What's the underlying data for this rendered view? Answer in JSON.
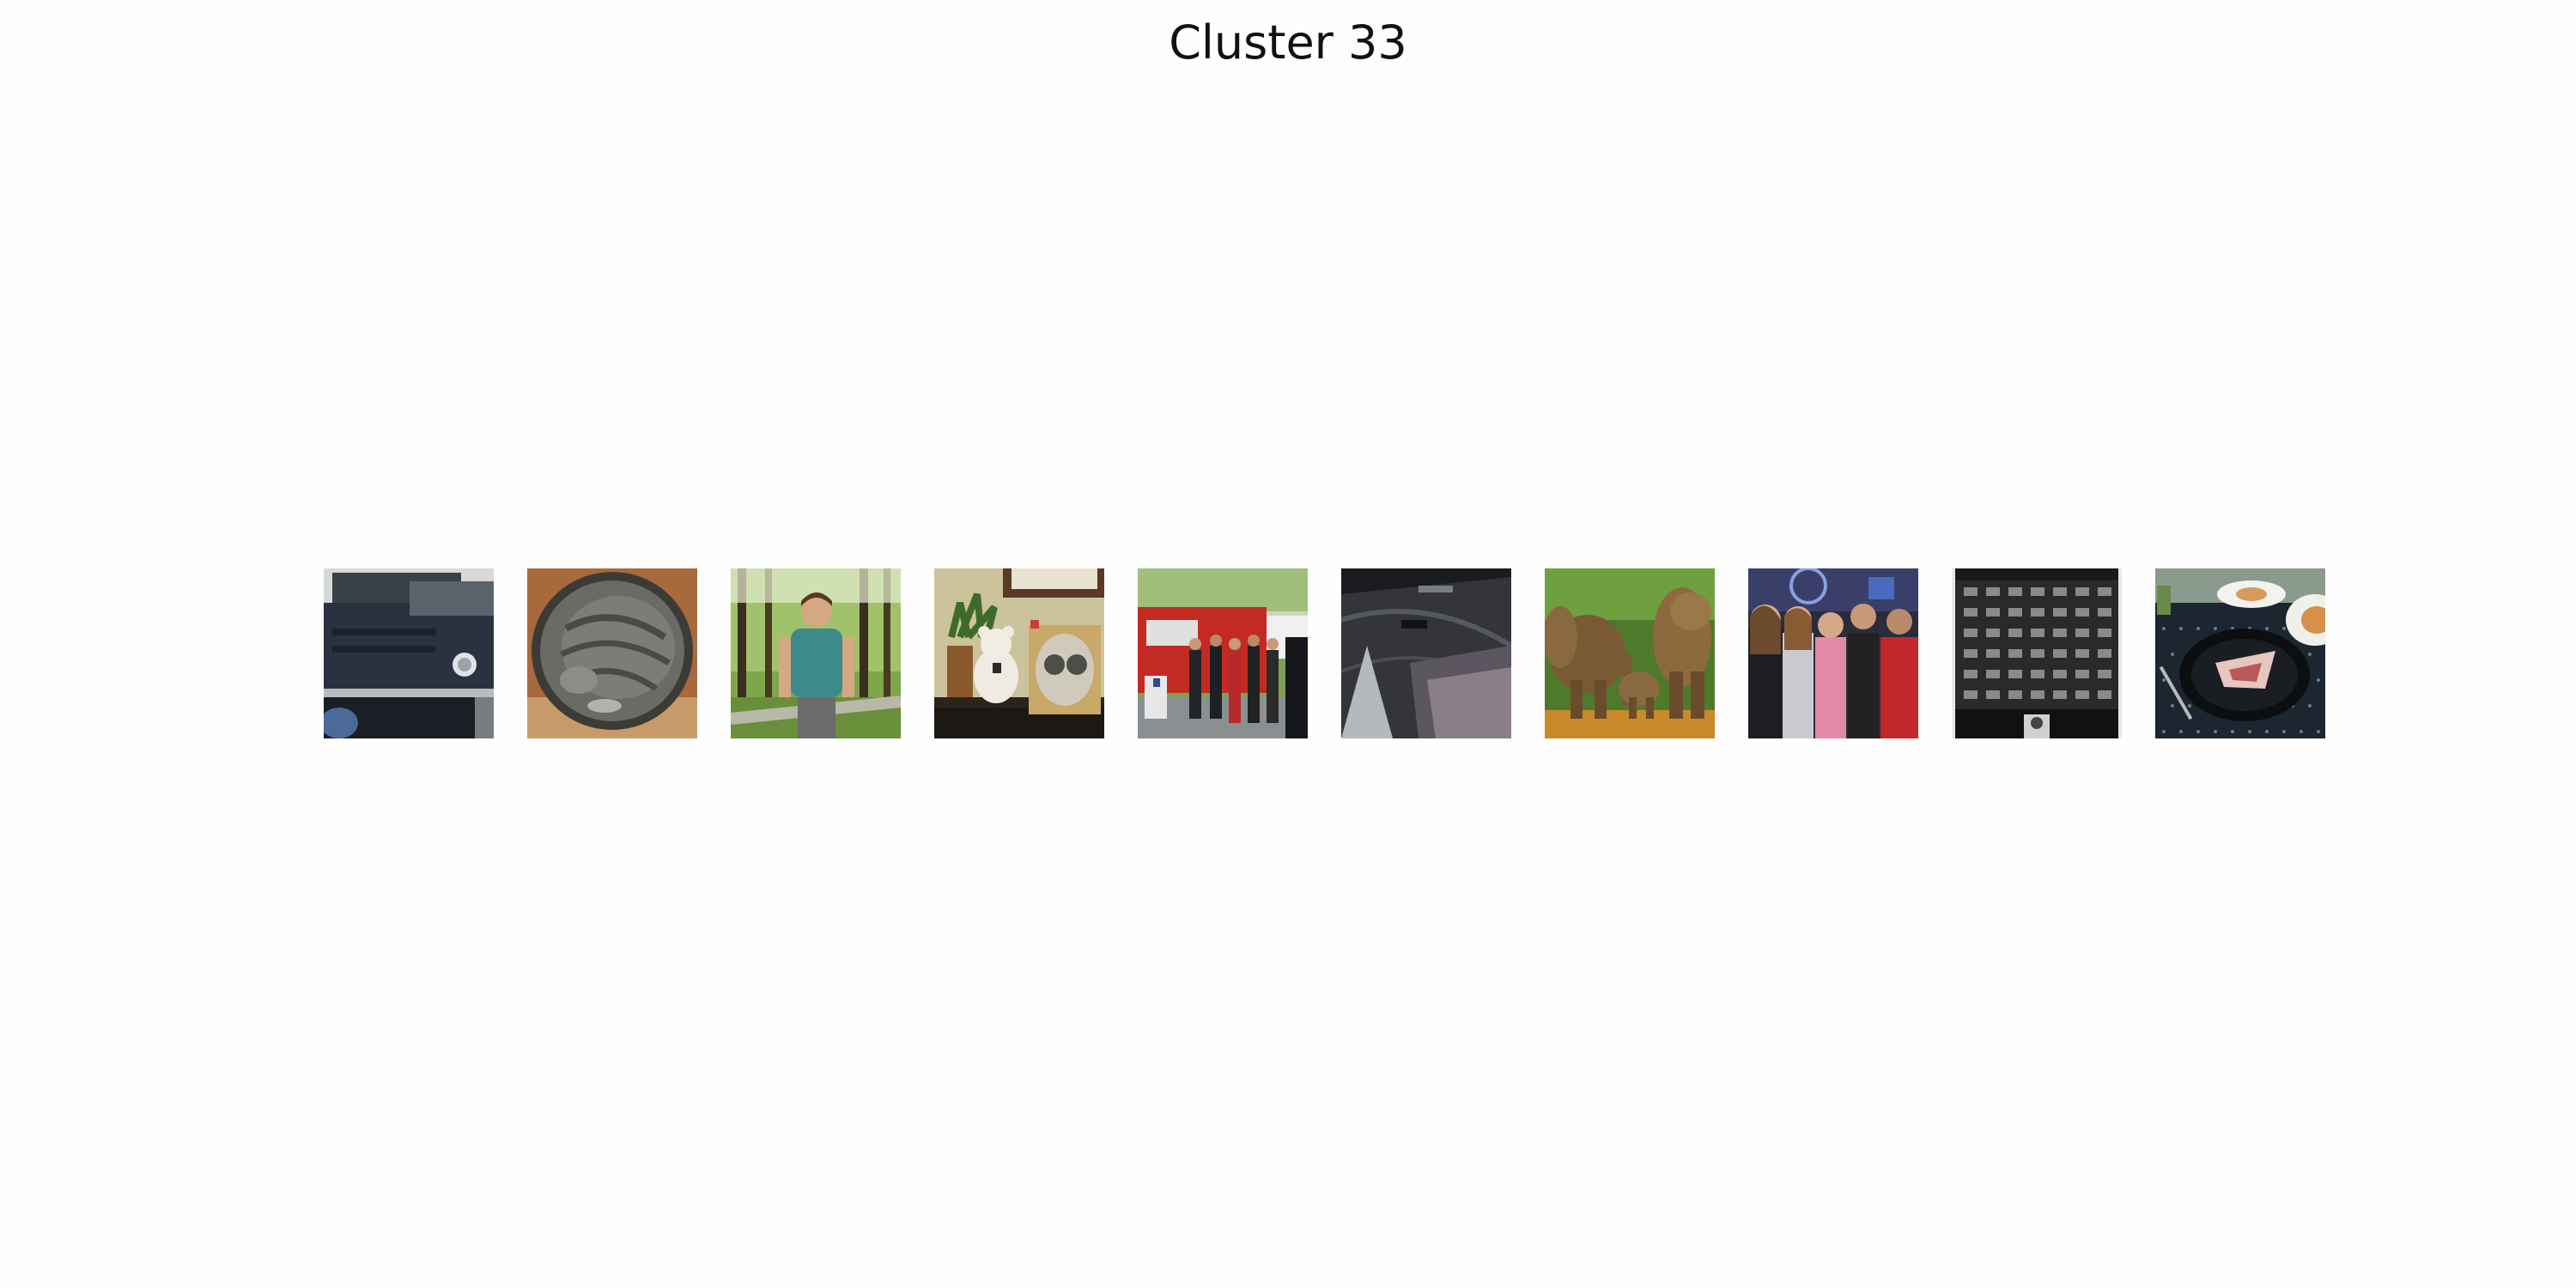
{
  "title": "Cluster 33",
  "thumbnails": [
    {
      "subject": "jeep-photo"
    },
    {
      "subject": "sleeping-cat-photo"
    },
    {
      "subject": "person-in-forest-photo"
    },
    {
      "subject": "teddy-bear-and-frame-photo"
    },
    {
      "subject": "food-truck-photo"
    },
    {
      "subject": "car-interior-photo"
    },
    {
      "subject": "elephants-photo"
    },
    {
      "subject": "crowd-photo"
    },
    {
      "subject": "building-facade-photo"
    },
    {
      "subject": "dinner-plate-photo"
    }
  ]
}
